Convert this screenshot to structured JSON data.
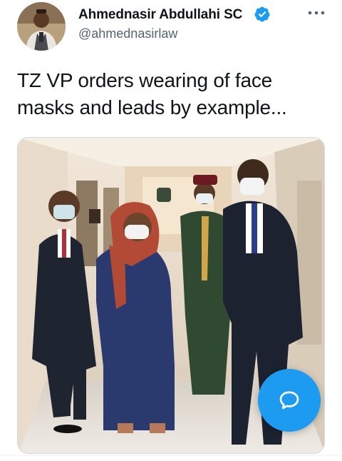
{
  "user": {
    "display_name": "Ahmednasir Abdullahi SC",
    "handle": "@ahmednasirlaw",
    "verified": true,
    "avatar_icon": "user-avatar-photo"
  },
  "tweet": {
    "text": "TZ VP orders wearing of face masks and leads by example..."
  },
  "media": {
    "type": "photo",
    "icon": "photo"
  },
  "icons": {
    "more": "more-horizontal-icon",
    "verified": "verified-badge-icon",
    "compose": "compose-reply-icon"
  },
  "colors": {
    "accent": "#1d9bf0",
    "text": "#0f1419",
    "secondary": "#536471"
  }
}
